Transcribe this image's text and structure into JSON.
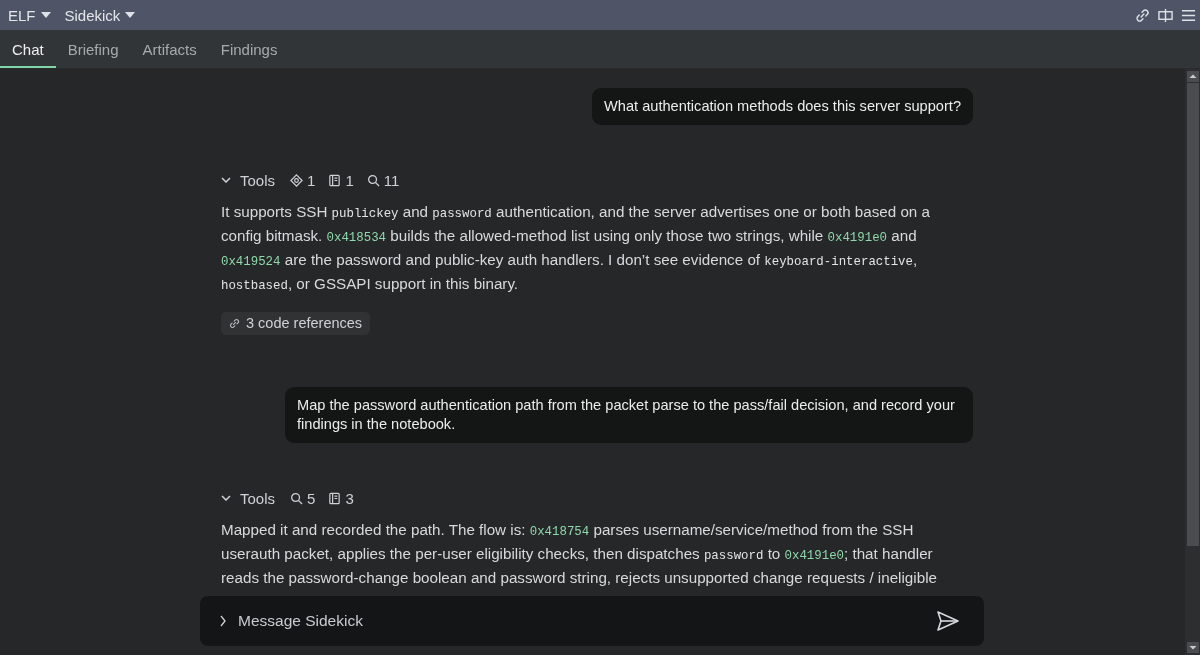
{
  "top_bar": {
    "menus": [
      {
        "label": "ELF"
      },
      {
        "label": "Sidekick"
      }
    ]
  },
  "tabs": [
    {
      "label": "Chat",
      "selected": true
    },
    {
      "label": "Briefing",
      "selected": false
    },
    {
      "label": "Artifacts",
      "selected": false
    },
    {
      "label": "Findings",
      "selected": false
    }
  ],
  "messages": [
    {
      "kind": "user",
      "text": "What authentication methods does this server support?"
    },
    {
      "kind": "assistant",
      "tools": {
        "label": "Tools",
        "counts": [
          {
            "kind": "view",
            "count": "1"
          },
          {
            "kind": "notebook",
            "count": "1"
          },
          {
            "kind": "search",
            "count": "11"
          }
        ]
      },
      "segments": [
        {
          "kind": "text",
          "text": "It supports SSH "
        },
        {
          "kind": "code",
          "text": "publickey"
        },
        {
          "kind": "text",
          "text": " and "
        },
        {
          "kind": "code",
          "text": "password"
        },
        {
          "kind": "text",
          "text": " authentication, and the server advertises one or both based on a config bitmask. "
        },
        {
          "kind": "address",
          "text": "0x418534"
        },
        {
          "kind": "text",
          "text": " builds the allowed-method list using only those two strings, while "
        },
        {
          "kind": "address",
          "text": "0x4191e0"
        },
        {
          "kind": "text",
          "text": " and "
        },
        {
          "kind": "address",
          "text": "0x419524"
        },
        {
          "kind": "text",
          "text": " are the password and public-key auth handlers. I don’t see evidence of "
        },
        {
          "kind": "code",
          "text": "keyboard-interactive"
        },
        {
          "kind": "text",
          "text": ", "
        },
        {
          "kind": "code",
          "text": "hostbased"
        },
        {
          "kind": "text",
          "text": ", or GSSAPI support in this binary."
        }
      ],
      "references": "3 code references"
    },
    {
      "kind": "user",
      "text": "Map the password authentication path from the packet parse to the pass/fail decision, and record your findings in the notebook."
    },
    {
      "kind": "assistant",
      "tools": {
        "label": "Tools",
        "counts": [
          {
            "kind": "search",
            "count": "5"
          },
          {
            "kind": "notebook",
            "count": "3"
          }
        ]
      },
      "segments": [
        {
          "kind": "text",
          "text": "Mapped it and recorded the path. The flow is: "
        },
        {
          "kind": "address",
          "text": "0x418754"
        },
        {
          "kind": "text",
          "text": " parses username/service/method from the SSH userauth packet, applies the per-user eligibility checks, then dispatches "
        },
        {
          "kind": "code",
          "text": "password"
        },
        {
          "kind": "text",
          "text": " to "
        },
        {
          "kind": "address",
          "text": "0x4191e0"
        },
        {
          "kind": "text",
          "text": "; that handler reads the password-change boolean and password string, rejects unsupported change requests / ineligible"
        }
      ]
    }
  ],
  "composer": {
    "placeholder": "Message Sidekick"
  }
}
